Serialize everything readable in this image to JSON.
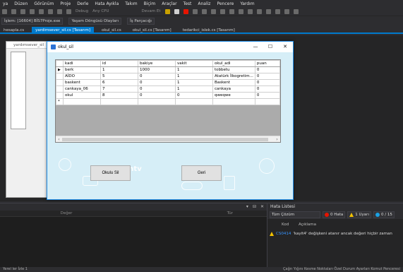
{
  "menu": [
    "ya",
    "Düzen",
    "Görünüm",
    "Proje",
    "Derle",
    "Hata Ayıkla",
    "Takım",
    "Biçim",
    "Araçlar",
    "Test",
    "Analiz",
    "Pencere",
    "Yardım"
  ],
  "toolbar": {
    "debug": "Debug",
    "cpu": "Any CPU",
    "start": "Devam Et"
  },
  "toolbar2": {
    "process": "İşlem: [16604] BİS7Proje.exe",
    "events": "Yaşam Döngüsü Olayları",
    "thread": "İş Parçacığı"
  },
  "tabs": [
    {
      "label": "hesapla.cs",
      "active": false
    },
    {
      "label": "yardimsever_sil.cs [Tasarım]",
      "active": true
    },
    {
      "label": "okul_sil.cs",
      "active": false
    },
    {
      "label": "okul_sil.cs [Tasarım]",
      "active": false
    },
    {
      "label": "tedarikci_islek.cs [Tasarım]",
      "active": false
    }
  ],
  "bg_form": {
    "title": "yardımsever_sil"
  },
  "form": {
    "title": "okul_sil",
    "minimize": "—",
    "maximize": "☐",
    "close": "✕",
    "logo": "mtv",
    "delete_button": "Okulu Sil",
    "back_button": "Geri"
  },
  "grid": {
    "columns": [
      "kadi",
      "id",
      "bakiye",
      "vakit",
      "okul_adi",
      "puan"
    ],
    "rows": [
      [
        "berk",
        "1",
        "1000",
        "1",
        "tobbetu",
        "0"
      ],
      [
        "AİDO",
        "5",
        "0",
        "1",
        "Atatürk İlkogretim...",
        "0"
      ],
      [
        "baskent",
        "6",
        "0",
        "1",
        "Baskent",
        "0"
      ],
      [
        "cankaya_06",
        "7",
        "0",
        "1",
        "cankaya",
        "0"
      ],
      [
        "okul",
        "8",
        "0",
        "0",
        "qweqwe",
        "0"
      ]
    ],
    "new_row_marker": "*"
  },
  "output": {
    "col1": "Değer",
    "col2": "Tür"
  },
  "error_list": {
    "title": "Hata Listesi",
    "scope": "Tüm Çözüm",
    "errors": "0 Hata",
    "warnings": "1 Uyarı",
    "messages": "0 / 15",
    "col_code": "Kod",
    "col_desc": "Açıklama",
    "row_code": "CS0414",
    "row_text": "'kayit4' değişkeni atanır ancak değeri hiçbir zaman"
  },
  "statusbar": {
    "left": "Yerel ler   İzle 1",
    "right": "Çağrı Yığını   Kesme Noktaları   Özel Durum Ayarları   Komut Penceresi"
  },
  "colors": {
    "accent": "#007acc",
    "form_bg": "#d6eef7",
    "error": "#e51400",
    "warning": "#f2c200",
    "info": "#1ba1e2"
  }
}
